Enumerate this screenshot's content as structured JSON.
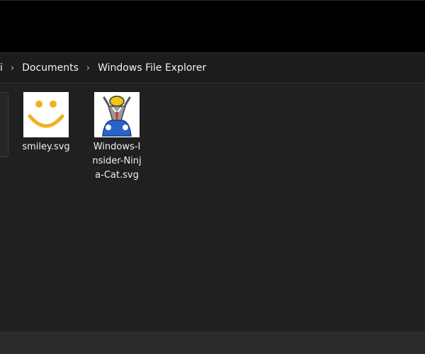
{
  "window": {
    "title": "Windows File Explorer"
  },
  "breadcrumb": {
    "partial_segment": "i",
    "items": [
      "Documents",
      "Windows File Explorer"
    ],
    "separator_icon": "chevron-right-icon"
  },
  "files": [
    {
      "name": "smiley.svg",
      "icon": "smiley-face-icon"
    },
    {
      "name": "Windows-Insider-Ninja-Cat.svg",
      "icon": "ninja-cat-icon"
    }
  ],
  "colors": {
    "background": "#000000",
    "content_background": "#202020",
    "address_bar": "#1c1c1c",
    "status_bar": "#2b2b2b",
    "smiley": "#f2b01e",
    "ninja_blue": "#2a62c9",
    "ninja_yellow": "#f1c40f"
  }
}
